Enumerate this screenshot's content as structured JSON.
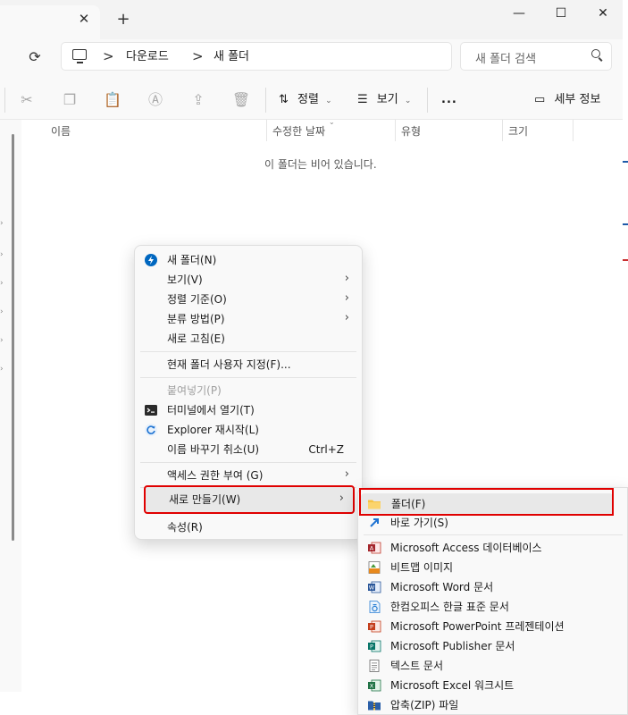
{
  "breadcrumb": {
    "items": [
      "다운로드",
      "새 폴더"
    ],
    "separator": ">"
  },
  "search": {
    "placeholder": "새 폴더 검색"
  },
  "toolbar": {
    "sort_label": "정렬",
    "view_label": "보기",
    "more_label": "...",
    "details_label": "세부 정보"
  },
  "columns": [
    "이름",
    "수정한 날짜",
    "유형",
    "크기"
  ],
  "empty_message": "이 폴더는 비어 있습니다.",
  "context_menu": {
    "items": [
      {
        "label": "새 폴더(N)",
        "icon": "new-folder-icon"
      },
      {
        "label": "보기(V)",
        "submenu": true
      },
      {
        "label": "정렬 기준(O)",
        "submenu": true
      },
      {
        "label": "분류 방법(P)",
        "submenu": true
      },
      {
        "label": "새로 고침(E)"
      },
      {
        "label": "현재 폴더 사용자 지정(F)..."
      },
      {
        "label": "붙여넣기(P)",
        "disabled": true
      },
      {
        "label": "터미널에서 열기(T)",
        "icon": "terminal-icon"
      },
      {
        "label": "Explorer 재시작(L)",
        "icon": "restart-icon"
      },
      {
        "label": "이름 바꾸기 취소(U)",
        "shortcut": "Ctrl+Z"
      },
      {
        "label": "액세스 권한 부여 (G)",
        "submenu": true
      },
      {
        "label": "새로 만들기(W)",
        "submenu": true,
        "highlighted": true
      },
      {
        "label": "속성(R)"
      }
    ]
  },
  "new_submenu": {
    "items": [
      {
        "label": "폴더(F)",
        "icon": "folder-icon",
        "highlighted": true
      },
      {
        "label": "바로 가기(S)",
        "icon": "shortcut-icon"
      },
      {
        "label": "Microsoft Access 데이터베이스",
        "icon": "access-icon"
      },
      {
        "label": "비트맵 이미지",
        "icon": "bitmap-icon"
      },
      {
        "label": "Microsoft Word 문서",
        "icon": "word-icon"
      },
      {
        "label": "한컴오피스 한글 표준 문서",
        "icon": "hwp-icon"
      },
      {
        "label": "Microsoft PowerPoint 프레젠테이션",
        "icon": "powerpoint-icon"
      },
      {
        "label": "Microsoft Publisher 문서",
        "icon": "publisher-icon"
      },
      {
        "label": "텍스트 문서",
        "icon": "text-document-icon"
      },
      {
        "label": "Microsoft Excel 워크시트",
        "icon": "excel-icon"
      },
      {
        "label": "압축(ZIP) 파일",
        "icon": "zip-icon"
      }
    ]
  },
  "colors": {
    "highlight_border": "#e00000",
    "folder": "#f6c343",
    "accent": "#0067c0"
  }
}
